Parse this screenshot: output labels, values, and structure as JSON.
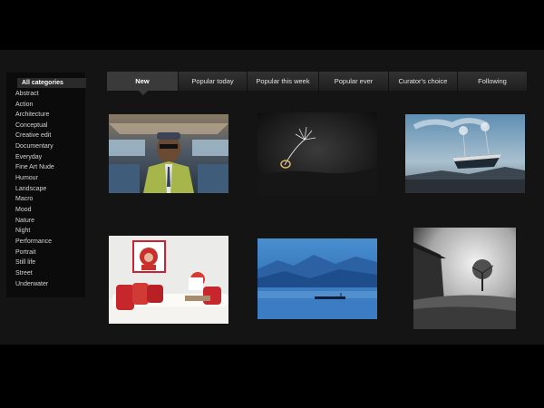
{
  "sidebar": {
    "categories": [
      {
        "label": "All categories",
        "active": true
      },
      {
        "label": "Abstract"
      },
      {
        "label": "Action"
      },
      {
        "label": "Architecture"
      },
      {
        "label": "Conceptual"
      },
      {
        "label": "Creative edit"
      },
      {
        "label": "Documentary"
      },
      {
        "label": "Everyday"
      },
      {
        "label": "Fine Art Nude"
      },
      {
        "label": "Humour"
      },
      {
        "label": "Landscape"
      },
      {
        "label": "Macro"
      },
      {
        "label": "Mood"
      },
      {
        "label": "Nature"
      },
      {
        "label": "Night"
      },
      {
        "label": "Performance"
      },
      {
        "label": "Portrait"
      },
      {
        "label": "Still life"
      },
      {
        "label": "Street"
      },
      {
        "label": "Underwater"
      }
    ]
  },
  "tabs": [
    {
      "label": "New",
      "active": true
    },
    {
      "label": "Popular today"
    },
    {
      "label": "Popular this week"
    },
    {
      "label": "Popular ever"
    },
    {
      "label": "Curator's choice"
    },
    {
      "label": "Following"
    }
  ],
  "photos": [
    {
      "subject": "man-on-bus-photo"
    },
    {
      "subject": "dandelion-seed-photo"
    },
    {
      "subject": "floating-boat-photo"
    },
    {
      "subject": "red-hood-child-photo"
    },
    {
      "subject": "blue-mountain-lake-photo"
    },
    {
      "subject": "tree-and-house-photo"
    }
  ],
  "colors": {
    "background": "#000000",
    "stage": "#141414",
    "sidebar": "#0b0b0b",
    "tab_bar": "#2a2a2a",
    "text": "#d4d4d4"
  }
}
